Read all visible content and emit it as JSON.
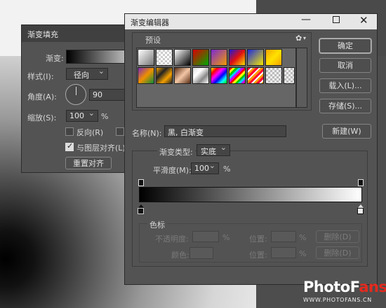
{
  "fill_dialog": {
    "title": "渐变填充",
    "gradient_label": "渐变:",
    "style_label": "样式(I):",
    "style_value": "径向",
    "angle_label": "角度(A):",
    "angle_value": "90",
    "scale_label": "缩放(S):",
    "scale_value": "100",
    "scale_unit": "%",
    "reverse_label": "反向(R)",
    "align_label": "与图层对齐(L)",
    "reset_label": "重置对齐"
  },
  "editor": {
    "title": "渐变编辑器",
    "presets_label": "预设",
    "ok_label": "确定",
    "cancel_label": "取消",
    "load_label": "载入(L)...",
    "save_label": "存储(S)...",
    "name_label": "名称(N):",
    "name_value": "黑, 白渐变",
    "new_label": "新建(W)",
    "type_label": "渐变类型:",
    "type_value": "实底",
    "smooth_label": "平滑度(M):",
    "smooth_value": "100",
    "smooth_unit": "%",
    "stops_label": "色标",
    "opacity_label": "不透明度:",
    "opacity_unit": "%",
    "position_label_1": "位置:",
    "position_unit_1": "%",
    "delete_label_1": "删除(D)",
    "color_label": "颜色:",
    "position_label_2": "位置:",
    "position_unit_2": "%",
    "delete_label_2": "删除(D)",
    "window_controls": [
      "minimize-icon",
      "maximize-icon",
      "close-icon"
    ]
  },
  "watermark": {
    "brand_main": "PhotoF",
    "brand_accent": "ans",
    "url": "WWW.PHOTOFANS.CN"
  },
  "colors": {
    "panel": "#535353",
    "accent_brand": "#e42a1e"
  }
}
